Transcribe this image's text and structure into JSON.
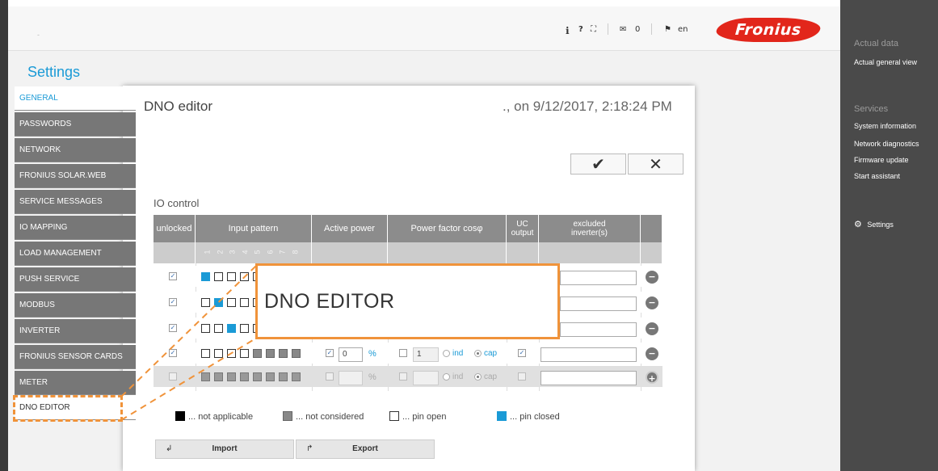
{
  "header": {
    "icons": [
      {
        "name": "info-icon",
        "glyph": "ℹ"
      },
      {
        "name": "help-icon",
        "glyph": "?"
      },
      {
        "name": "fullscreen-icon",
        "glyph": "⛶"
      },
      {
        "name": "mail-icon",
        "glyph": "✉"
      },
      {
        "name": "flag-icon",
        "glyph": "⚑"
      }
    ],
    "mail_count": "0",
    "language": "en",
    "logo_text": "Fronius",
    "tab_dot": "-"
  },
  "page_title": "Settings",
  "menu": {
    "items": [
      {
        "label": "GENERAL"
      },
      {
        "label": "PASSWORDS"
      },
      {
        "label": "NETWORK"
      },
      {
        "label": "FRONIUS SOLAR.WEB"
      },
      {
        "label": "SERVICE MESSAGES"
      },
      {
        "label": "IO MAPPING"
      },
      {
        "label": "LOAD MANAGEMENT"
      },
      {
        "label": "PUSH SERVICE"
      },
      {
        "label": "MODBUS"
      },
      {
        "label": "INVERTER"
      },
      {
        "label": "FRONIUS SENSOR CARDS"
      },
      {
        "label": "METER"
      },
      {
        "label": "DNO EDITOR"
      }
    ]
  },
  "rightbar": {
    "actual_data_heading": "Actual data",
    "actual_general_view": "Actual general view",
    "services_heading": "Services",
    "system_information": "System information",
    "network_diagnostics": "Network diagnostics",
    "firmware_update": "Firmware update",
    "start_assistant": "Start assistant",
    "settings": "Settings"
  },
  "dialog": {
    "title": "DNO editor",
    "date": "., on 9/12/2017, 2:18:24 PM",
    "confirm_glyph": "✔",
    "cancel_glyph": "✕",
    "io_title": "IO control",
    "headers": {
      "unlocked": "unlocked",
      "input_pattern": "Input pattern",
      "active_power": "Active power",
      "power_factor": "Power factor cosφ",
      "uc_output": "UC output",
      "excluded": "excluded inverter(s)"
    },
    "pin_numbers": [
      "1",
      "2",
      "3",
      "4",
      "5",
      "6",
      "7",
      "8"
    ],
    "row4": {
      "active_power": "0",
      "pct": "%",
      "power_factor": "1",
      "ind": "ind",
      "cap": "cap"
    },
    "row5": {
      "pct": "%",
      "ind": "ind",
      "cap": "cap"
    },
    "remove_glyph": "−",
    "add_glyph": "+"
  },
  "callout_text": "DNO EDITOR",
  "legend": {
    "not_applicable": "... not applicable",
    "not_considered": "... not considered",
    "pin_open": "... pin open",
    "pin_closed": "... pin closed"
  },
  "buttons": {
    "import": "Import",
    "export": "Export",
    "import_glyph": "↲",
    "export_glyph": "↱"
  },
  "colors": {
    "accent": "#1a9ad6",
    "highlight": "#f0933a",
    "logo": "#e2261b"
  }
}
